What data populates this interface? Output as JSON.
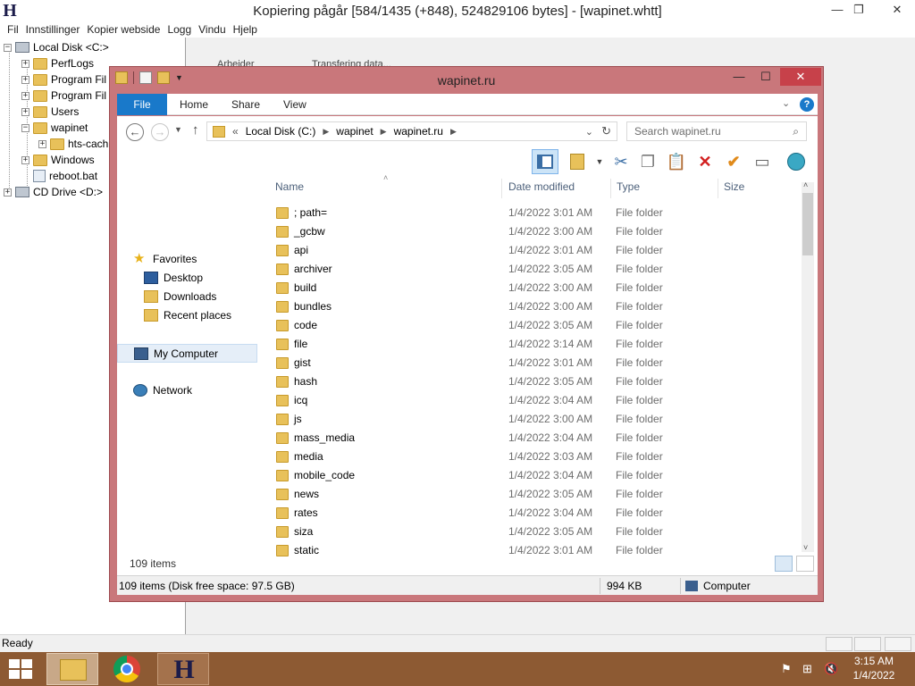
{
  "httrack": {
    "title": "Kopiering pågår [584/1435 (+848), 524829106 bytes] - [wapinet.whtt]",
    "logo": "H",
    "menu": [
      "Fil",
      "Innstillinger",
      "Kopier webside",
      "Logg",
      "Vindu",
      "Hjelp"
    ],
    "bg_labels": {
      "arbeider": "Arbeider",
      "transfer": "Transfering data..."
    },
    "tree": [
      {
        "label": "Local Disk <C:>",
        "kind": "drive"
      },
      {
        "label": "PerfLogs",
        "kind": "folder"
      },
      {
        "label": "Program Fil",
        "kind": "folder"
      },
      {
        "label": "Program Fil",
        "kind": "folder"
      },
      {
        "label": "Users",
        "kind": "folder"
      },
      {
        "label": "wapinet",
        "kind": "folder"
      },
      {
        "label": "hts-cach",
        "kind": "folder"
      },
      {
        "label": "Windows",
        "kind": "folder"
      },
      {
        "label": "reboot.bat",
        "kind": "file"
      },
      {
        "label": "CD Drive <D:>",
        "kind": "drive"
      }
    ],
    "status": "Ready"
  },
  "explorer": {
    "title": "wapinet.ru",
    "ribbon": {
      "file": "File",
      "home": "Home",
      "share": "Share",
      "view": "View"
    },
    "address": {
      "sep": "«",
      "crumbs": [
        "Local Disk (C:)",
        "wapinet",
        "wapinet.ru"
      ]
    },
    "search_placeholder": "Search wapinet.ru",
    "nav": {
      "favorites": "Favorites",
      "desktop": "Desktop",
      "downloads": "Downloads",
      "recent": "Recent places",
      "computer": "My Computer",
      "network": "Network"
    },
    "columns": {
      "name": "Name",
      "date": "Date modified",
      "type": "Type",
      "size": "Size"
    },
    "files": [
      {
        "name": "; path=",
        "date": "1/4/2022 3:01 AM",
        "type": "File folder"
      },
      {
        "name": "_gcbw",
        "date": "1/4/2022 3:00 AM",
        "type": "File folder"
      },
      {
        "name": "api",
        "date": "1/4/2022 3:01 AM",
        "type": "File folder"
      },
      {
        "name": "archiver",
        "date": "1/4/2022 3:05 AM",
        "type": "File folder"
      },
      {
        "name": "build",
        "date": "1/4/2022 3:00 AM",
        "type": "File folder"
      },
      {
        "name": "bundles",
        "date": "1/4/2022 3:00 AM",
        "type": "File folder"
      },
      {
        "name": "code",
        "date": "1/4/2022 3:05 AM",
        "type": "File folder"
      },
      {
        "name": "file",
        "date": "1/4/2022 3:14 AM",
        "type": "File folder"
      },
      {
        "name": "gist",
        "date": "1/4/2022 3:01 AM",
        "type": "File folder"
      },
      {
        "name": "hash",
        "date": "1/4/2022 3:05 AM",
        "type": "File folder"
      },
      {
        "name": "icq",
        "date": "1/4/2022 3:04 AM",
        "type": "File folder"
      },
      {
        "name": "js",
        "date": "1/4/2022 3:00 AM",
        "type": "File folder"
      },
      {
        "name": "mass_media",
        "date": "1/4/2022 3:04 AM",
        "type": "File folder"
      },
      {
        "name": "media",
        "date": "1/4/2022 3:03 AM",
        "type": "File folder"
      },
      {
        "name": "mobile_code",
        "date": "1/4/2022 3:04 AM",
        "type": "File folder"
      },
      {
        "name": "news",
        "date": "1/4/2022 3:05 AM",
        "type": "File folder"
      },
      {
        "name": "rates",
        "date": "1/4/2022 3:04 AM",
        "type": "File folder"
      },
      {
        "name": "siza",
        "date": "1/4/2022 3:05 AM",
        "type": "File folder"
      },
      {
        "name": "static",
        "date": "1/4/2022 3:01 AM",
        "type": "File folder"
      }
    ],
    "items_count": "109 items",
    "status": {
      "left": "109 items (Disk free space: 97.5 GB)",
      "size": "994 KB",
      "location": "Computer"
    }
  },
  "taskbar": {
    "time": "3:15 AM",
    "date": "1/4/2022"
  },
  "colors": {
    "explorer_frame": "#c9777b",
    "ribbon_file": "#1979ca",
    "close_button": "#c7414a",
    "taskbar": "#8d5a33"
  }
}
